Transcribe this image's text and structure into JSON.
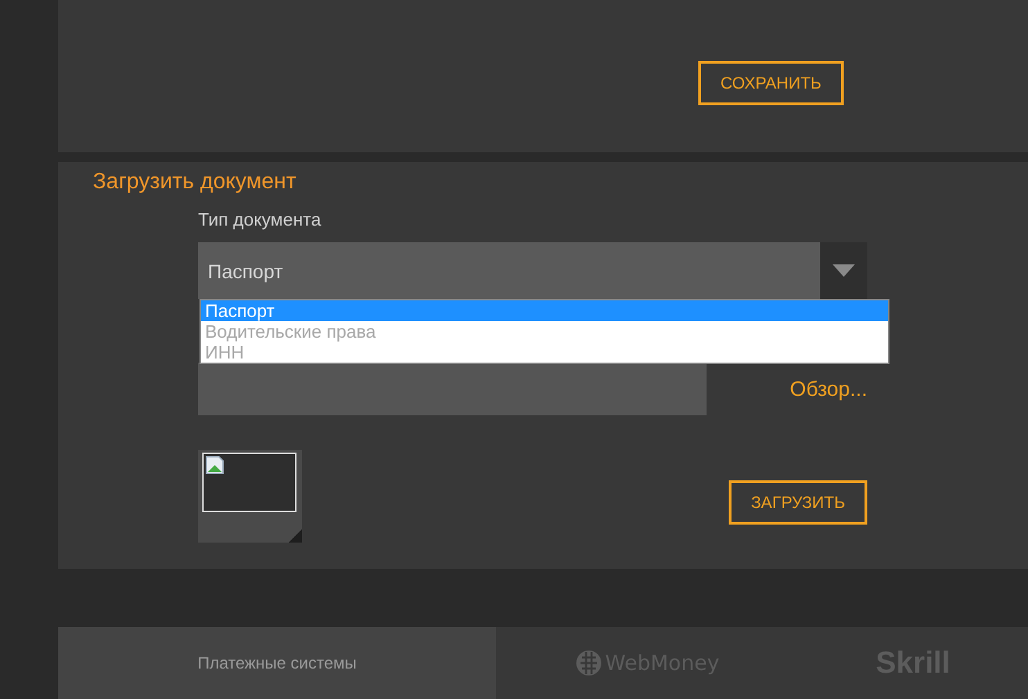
{
  "save_button": "СОХРАНИТЬ",
  "upload": {
    "title": "Загрузить документ",
    "doc_type": {
      "label": "Тип документа",
      "value": "Паспорт",
      "expanded": true,
      "options": [
        {
          "label": "Паспорт",
          "selected": true
        },
        {
          "label": "Водительские права",
          "selected": false
        },
        {
          "label": "ИНН",
          "selected": false
        }
      ]
    },
    "browse_link": "Обзор...",
    "upload_button": "ЗАГРУЗИТЬ"
  },
  "footer": {
    "tabs": [
      {
        "label": "Платежные системы",
        "kind": "text",
        "selected": true
      },
      {
        "label": "WebMoney",
        "kind": "webmoney",
        "selected": false
      },
      {
        "label": "Skrill",
        "kind": "skrill",
        "selected": false
      }
    ]
  }
}
